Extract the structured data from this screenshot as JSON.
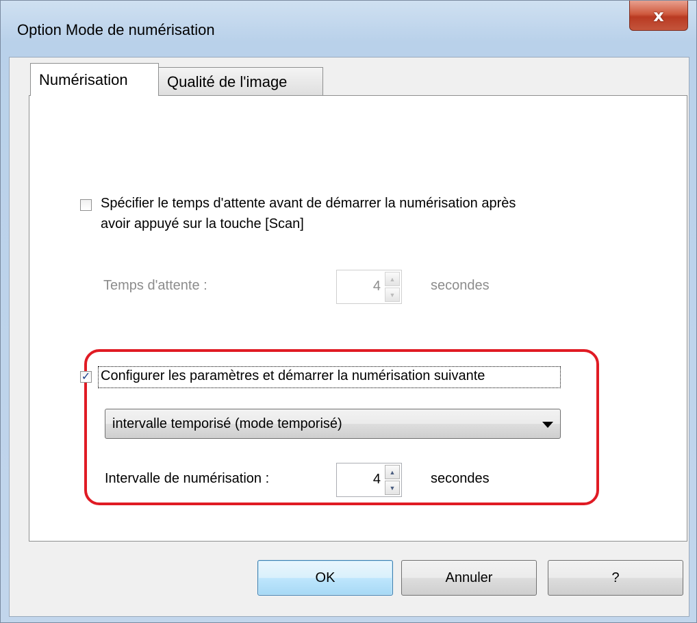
{
  "window": {
    "title": "Option Mode de numérisation",
    "close_label": "x"
  },
  "tabs": [
    {
      "label": "Numérisation",
      "active": true
    },
    {
      "label": "Qualité de l'image",
      "active": false
    }
  ],
  "wait_section": {
    "checkbox_checked": false,
    "checkbox_label_line1": "Spécifier le temps d'attente avant de démarrer la numérisation après",
    "checkbox_label_line2": "avoir appuyé sur la touche [Scan]",
    "field_label": "Temps d'attente :",
    "value": "4",
    "unit": "secondes",
    "enabled": false
  },
  "next_scan_section": {
    "checkbox_checked": true,
    "checkbox_label": "Configurer les paramètres et démarrer la numérisation suivante",
    "mode_selected": "intervalle temporisé (mode temporisé)",
    "interval_label": "Intervalle de numérisation :",
    "interval_value": "4",
    "unit": "secondes",
    "highlight_color": "#e01b24"
  },
  "buttons": {
    "ok": "OK",
    "cancel": "Annuler",
    "help": "?"
  },
  "icons": {
    "spin_up": "▲",
    "spin_down": "▼",
    "check": "✓"
  }
}
